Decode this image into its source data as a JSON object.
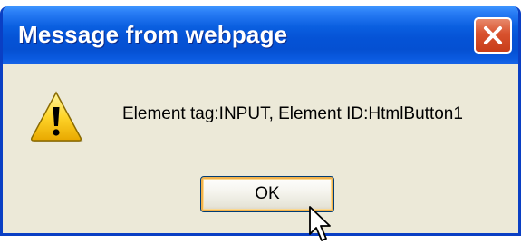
{
  "window": {
    "title": "Message from webpage",
    "close_icon": "close-icon"
  },
  "dialog": {
    "icon": "warning-icon",
    "message": "Element tag:INPUT, Element ID:HtmlButton1",
    "ok_label": "OK"
  },
  "colors": {
    "titlebar": "#0553d6",
    "body": "#ece9d8",
    "close_button": "#d8512d",
    "button_focus": "#f2b24c"
  }
}
